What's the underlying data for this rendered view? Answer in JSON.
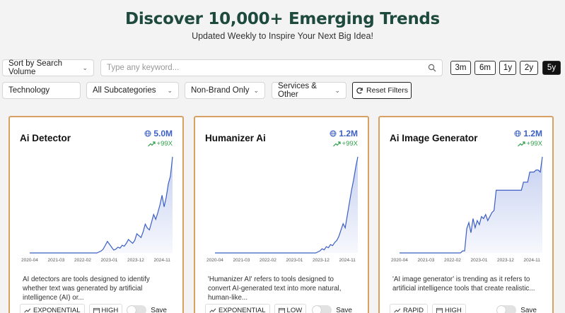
{
  "header": {
    "title": "Discover 10,000+ Emerging Trends",
    "subtitle": "Updated Weekly to Inspire Your Next Big Idea!"
  },
  "filters": {
    "sort": "Sort by Search Volume",
    "search_placeholder": "Type any keyword...",
    "category": "Technology",
    "subcategory": "All Subcategories",
    "brand": "Non-Brand Only",
    "services": "Services & Other",
    "reset_label": "Reset Filters"
  },
  "timeframes": [
    {
      "label": "3m",
      "active": false
    },
    {
      "label": "6m",
      "active": false
    },
    {
      "label": "1y",
      "active": false
    },
    {
      "label": "2y",
      "active": false
    },
    {
      "label": "5y",
      "active": true
    }
  ],
  "colors": {
    "accent": "#3b5fc4",
    "card_border": "#d9a063",
    "growth": "#2f9e4a",
    "title": "#1e4a3d"
  },
  "x_ticks": [
    "2020-04",
    "2021-03",
    "2022-02",
    "2023-01",
    "2023-12",
    "2024-11"
  ],
  "cards": [
    {
      "name": "Ai Detector",
      "volume": "5.0M",
      "growth": "+99X",
      "description": "AI detectors are tools designed to identify whether text was generated by artificial intelligence (AI) or...",
      "trend_type": "EXPONENTIAL",
      "competition": "HIGH",
      "save_label": "Save",
      "series": [
        0,
        0,
        0,
        0,
        0,
        0,
        0,
        0,
        0,
        0,
        0,
        0,
        0,
        0,
        0,
        0,
        0,
        0,
        0,
        0,
        0,
        0,
        0,
        0,
        0,
        0,
        0,
        0,
        0,
        0,
        0,
        0,
        0,
        1,
        2,
        4,
        8,
        12,
        9,
        6,
        3,
        4,
        6,
        5,
        8,
        7,
        10,
        14,
        12,
        10,
        13,
        20,
        18,
        16,
        22,
        30,
        26,
        24,
        32,
        40,
        35,
        42,
        50,
        60,
        48,
        58,
        72,
        80,
        100
      ]
    },
    {
      "name": "Humanizer Ai",
      "volume": "1.2M",
      "growth": "+99X",
      "description": "'Humanizer AI' refers to tools designed to convert AI-generated text into more natural, human-like...",
      "trend_type": "EXPONENTIAL",
      "competition": "LOW",
      "save_label": "Save",
      "series": [
        0,
        0,
        0,
        0,
        0,
        0,
        0,
        0,
        0,
        0,
        0,
        0,
        0,
        0,
        0,
        0,
        0,
        0,
        0,
        0,
        0,
        0,
        0,
        0,
        0,
        0,
        0,
        0,
        0,
        0,
        0,
        0,
        0,
        0,
        0,
        0,
        0,
        0,
        0,
        0,
        0,
        0,
        0,
        0,
        0,
        0,
        0,
        0,
        0,
        1,
        2,
        4,
        3,
        6,
        5,
        8,
        7,
        10,
        12,
        16,
        22,
        28,
        24,
        36,
        48,
        60,
        70,
        82,
        92
      ]
    },
    {
      "name": "Ai Image Generator",
      "volume": "1.2M",
      "growth": "+99X",
      "description": "'AI image generator' is trending as it refers to artificial intelligence tools that create realistic...",
      "trend_type": "RAPID",
      "competition": "HIGH",
      "save_label": "Save",
      "series": [
        0,
        0,
        0,
        0,
        0,
        0,
        0,
        0,
        0,
        0,
        0,
        0,
        0,
        0,
        0,
        0,
        0,
        0,
        0,
        0,
        0,
        0,
        0,
        0,
        0,
        0,
        0,
        0,
        0,
        0,
        2,
        2,
        24,
        30,
        20,
        34,
        25,
        32,
        28,
        36,
        34,
        38,
        32,
        36,
        40,
        42,
        62,
        62,
        62,
        62,
        62,
        62,
        62,
        62,
        62,
        62,
        62,
        62,
        62,
        70,
        70,
        70,
        80,
        80,
        80,
        82,
        82,
        80,
        95
      ]
    }
  ]
}
